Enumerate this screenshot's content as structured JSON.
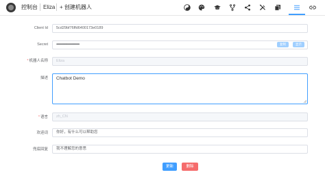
{
  "header": {
    "breadcrumb": [
      "控制台",
      "Eliza"
    ],
    "create_label": "+ 创建机器人",
    "icons": [
      "yin-yang-icon",
      "palette-icon",
      "graduation-cap-icon",
      "fork-icon",
      "share-icon",
      "tools-icon",
      "copy-icon",
      "list-icon",
      "link-icon"
    ]
  },
  "form": {
    "client_id": {
      "label": "Client Id",
      "value": "5cd29bf76ffd6400173e0189"
    },
    "secret": {
      "label": "Secret",
      "value": "••••••••••••••••••••••••••••••••••••",
      "copy_label": "复制",
      "reset_label": "显示"
    },
    "name": {
      "label": "机器人名称",
      "value": "Eliza"
    },
    "description": {
      "label": "描述",
      "value": "Chatbot Demo"
    },
    "language": {
      "label": "语言",
      "value": "zh_CN"
    },
    "welcome": {
      "label": "欢迎词",
      "value": "你好，有什么可以帮助您"
    },
    "fallback": {
      "label": "兜底回复",
      "value": "我不理解您的意思"
    }
  },
  "actions": {
    "update_label": "更新",
    "delete_label": "删除"
  },
  "colors": {
    "primary": "#409eff",
    "danger": "#f56c6c",
    "required": "#f56c6c"
  }
}
